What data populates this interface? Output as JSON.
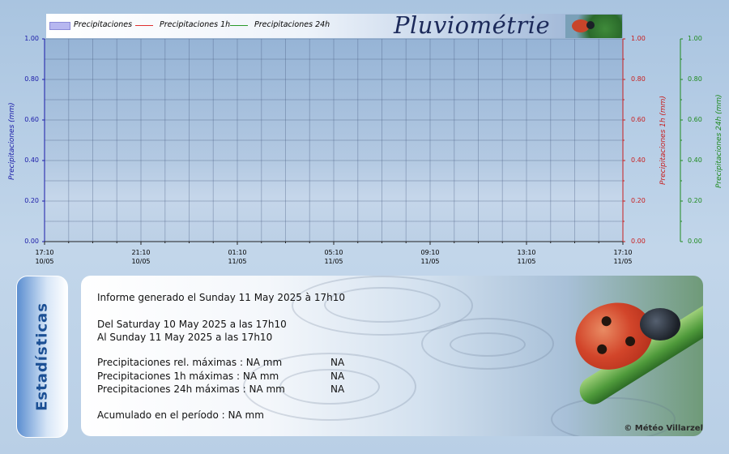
{
  "chart": {
    "title": "Pluviométrie",
    "legend": [
      {
        "label": "Precipitaciones",
        "type": "bar",
        "color": "#b7b7f0"
      },
      {
        "label": "Precipitaciones 1h",
        "type": "line",
        "color": "#e03030"
      },
      {
        "label": "Precipitaciones 24h",
        "type": "line",
        "color": "#2a9a2a"
      }
    ],
    "left_axis_title": "Precipitaciones (mm)",
    "right1_axis_title": "Precipitaciones 1h (mm)",
    "right2_axis_title": "Precipitaciones 24h (mm)"
  },
  "chart_data": {
    "type": "bar",
    "x": [
      "17:10 10/05",
      "21:10 10/05",
      "01:10 11/05",
      "05:10 11/05",
      "09:10 11/05",
      "13:10 11/05",
      "17:10 11/05"
    ],
    "x_tick_times": [
      "17:10",
      "21:10",
      "01:10",
      "05:10",
      "09:10",
      "13:10",
      "17:10"
    ],
    "x_tick_dates": [
      "10/05",
      "10/05",
      "11/05",
      "11/05",
      "11/05",
      "11/05",
      "11/05"
    ],
    "series": [
      {
        "name": "Precipitaciones",
        "values": [],
        "color": "#b7b7f0"
      },
      {
        "name": "Precipitaciones 1h",
        "values": [],
        "color": "#e03030"
      },
      {
        "name": "Precipitaciones 24h",
        "values": [],
        "color": "#2a9a2a"
      }
    ],
    "ylim": [
      0,
      1
    ],
    "y_ticks": [
      "0.00",
      "0.20",
      "0.40",
      "0.60",
      "0.80",
      "1.00"
    ],
    "ylabel": "Precipitaciones (mm)",
    "ylabel_right_1": "Precipitaciones 1h (mm)",
    "ylabel_right_2": "Precipitaciones 24h (mm)",
    "grid": true,
    "legend_position": "top"
  },
  "stats": {
    "tab_label": "Estadísticas",
    "generated": "Informe generado el Sunday 11 May 2025 à 17h10",
    "from": "Del Saturday 10 May 2025 a las 17h10",
    "to": "Al Sunday 11 May 2025 a las 17h10",
    "rows": [
      {
        "label": "Precipitaciones rel. máximas : NA mm",
        "value": "NA"
      },
      {
        "label": "Precipitaciones 1h máximas : NA mm",
        "value": "NA"
      },
      {
        "label": "Precipitaciones 24h máximas : NA mm",
        "value": "NA"
      }
    ],
    "accumulated": "Acumulado en el período : NA mm",
    "copyright": "© Météo Villarzel"
  }
}
